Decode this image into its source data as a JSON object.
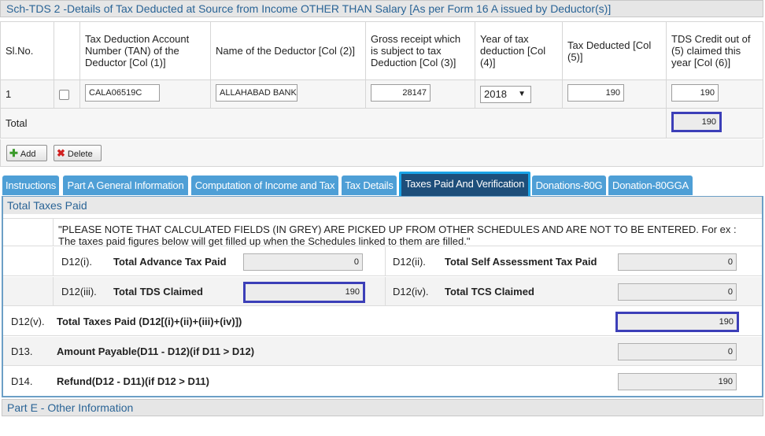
{
  "schedule": {
    "title": "Sch-TDS 2 -Details of Tax Deducted at Source from Income OTHER THAN Salary [As per Form 16 A issued by Deductor(s)]",
    "columns": [
      "Sl.No.",
      "Tax Deduction Account Number (TAN) of the Deductor [Col (1)]",
      "Name of the Deductor [Col (2)]",
      "Gross receipt which is subject to tax Deduction [Col (3)]",
      "Year of tax deduction [Col (4)]",
      "Tax Deducted [Col (5)]",
      "TDS Credit out of (5) claimed this year [Col (6)]"
    ],
    "rows": [
      {
        "sl_no": "1",
        "tan": "CALA06519C",
        "deductor_name": "ALLAHABAD BANK",
        "gross_receipt": "28147",
        "year": "2018",
        "tax_deducted": "190",
        "tds_claimed": "190"
      }
    ],
    "total_label": "Total",
    "total_value": "190",
    "add_label": "Add",
    "delete_label": "Delete"
  },
  "tabs": [
    "Instructions",
    "Part A General Information",
    "Computation of Income and Tax",
    "Tax Details",
    "Taxes Paid And Verification",
    "Donations-80G",
    "Donation-80GGA"
  ],
  "active_tab": "Taxes Paid And Verification",
  "total_taxes_paid": {
    "title": "Total Taxes Paid",
    "note": "\"PLEASE NOTE THAT CALCULATED FIELDS (IN GREY) ARE PICKED UP FROM OTHER SCHEDULES AND ARE NOT TO BE ENTERED. For ex : The taxes paid figures below will get filled up when the Schedules linked to them are filled.\"",
    "advance_tax": {
      "code": "D12(i).",
      "label": "Total Advance Tax Paid",
      "value": "0"
    },
    "self_assessment": {
      "code": "D12(ii).",
      "label": "Total Self Assessment Tax Paid",
      "value": "0"
    },
    "tds_claimed": {
      "code": "D12(iii).",
      "label": "Total TDS Claimed",
      "value": "190"
    },
    "tcs_claimed": {
      "code": "D12(iv).",
      "label": "Total TCS Claimed",
      "value": "0"
    },
    "total_taxes": {
      "code": "D12(v).",
      "label": "Total Taxes Paid (D12[(i)+(ii)+(iii)+(iv)])",
      "value": "190"
    },
    "amount_payable": {
      "code": "D13.",
      "label": "Amount Payable(D11 - D12)(if D11 > D12)",
      "value": "0"
    },
    "refund": {
      "code": "D14.",
      "label": "Refund(D12 - D11)(if D12 > D11)",
      "value": "190"
    }
  },
  "next_section": "Part E - Other Information",
  "colors": {
    "tab": "#4e9fd6",
    "tab_active": "#1d4e7a",
    "highlight": "#3c3fb8",
    "section_title": "#2a6496"
  }
}
